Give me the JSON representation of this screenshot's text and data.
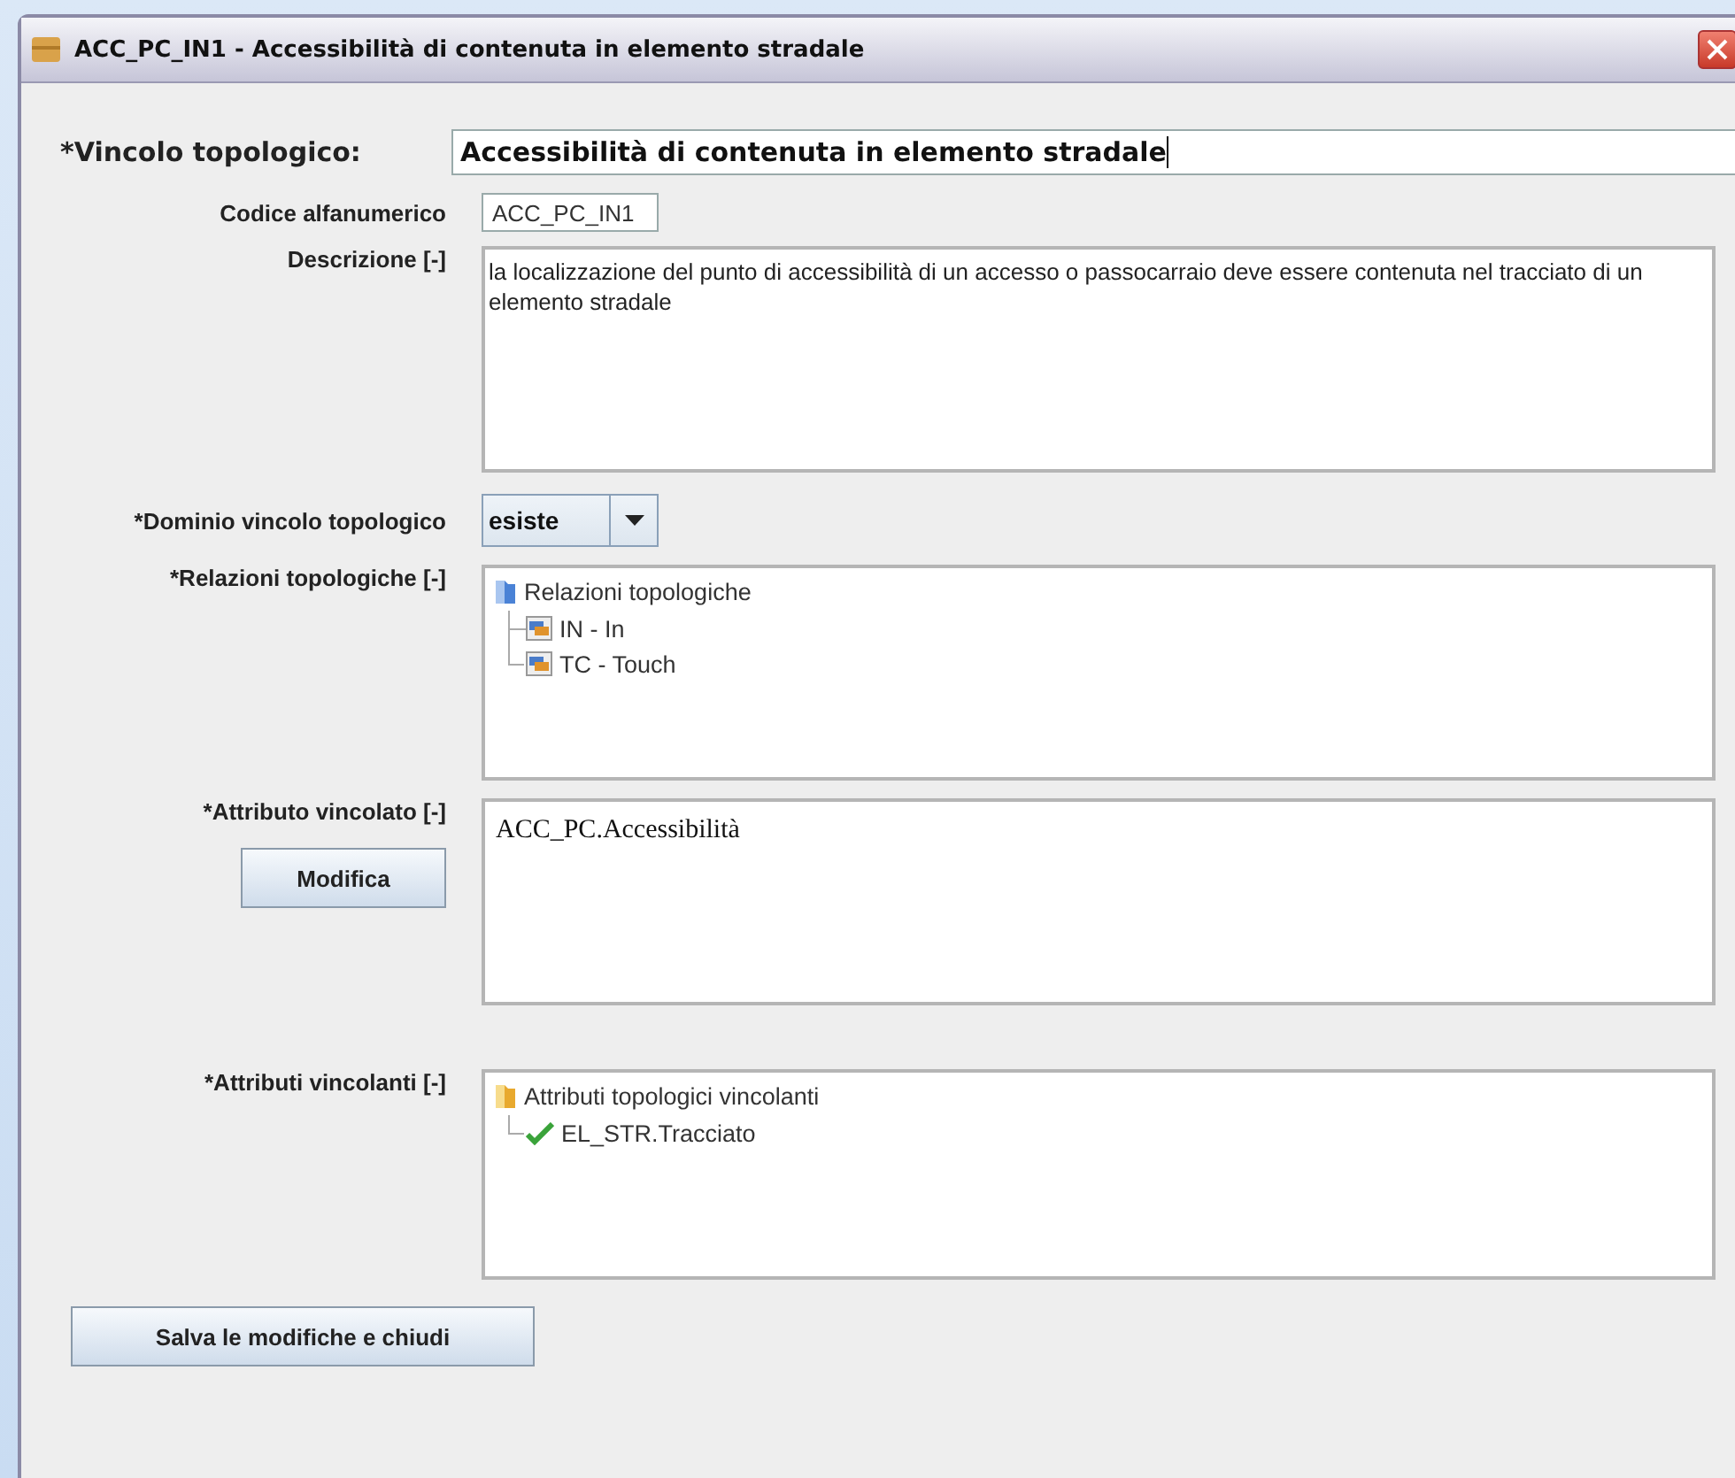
{
  "window": {
    "title": "ACC_PC_IN1 - Accessibilità di  contenuta in elemento stradale"
  },
  "vincolo": {
    "label": "*Vincolo topologico:",
    "value": "Accessibilità di  contenuta in elemento stradale"
  },
  "codice": {
    "label": "Codice alfanumerico",
    "value": "ACC_PC_IN1"
  },
  "descrizione": {
    "label": "Descrizione [-]",
    "value": "la localizzazione del punto di accessibilità di un accesso o passocarraio deve essere contenuta nel tracciato di un elemento stradale"
  },
  "dominio": {
    "label": "*Dominio vincolo topologico",
    "value": "esiste"
  },
  "relazioni": {
    "label": "*Relazioni topologiche [-]",
    "tree": {
      "label": "Relazioni topologiche",
      "kind": "folder",
      "children": [
        {
          "label": "IN - In",
          "kind": "relation"
        },
        {
          "label": "TC - Touch",
          "kind": "relation"
        }
      ]
    }
  },
  "attributo": {
    "label": "*Attributo vincolato [-]",
    "button": "Modifica",
    "value": "ACC_PC.Accessibilità"
  },
  "vincolanti": {
    "label": "*Attributi vincolanti [-]",
    "tree": {
      "label": "Attributi topologici vincolanti",
      "kind": "folder",
      "children": [
        {
          "label": "EL_STR.Tracciato",
          "kind": "check"
        }
      ]
    }
  },
  "save_button": "Salva le modifiche e chiudi"
}
